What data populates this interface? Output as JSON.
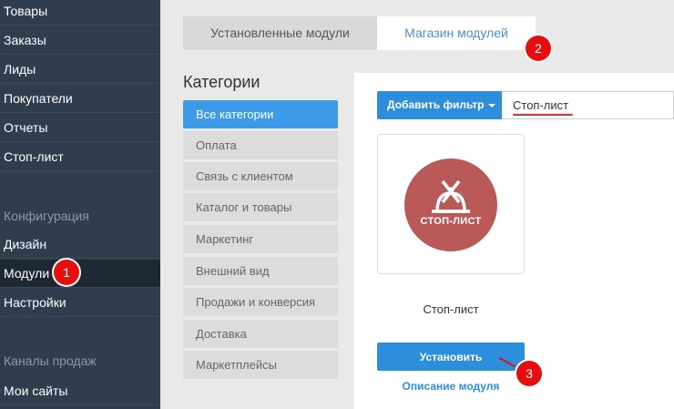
{
  "sidebar": {
    "items_top": [
      "Товары",
      "Заказы",
      "Лиды",
      "Покупатели",
      "Отчеты",
      "Стоп-лист"
    ],
    "config_header": "Конфигурация",
    "config_items": [
      "Дизайн",
      "Модули",
      "Настройки"
    ],
    "sales_header": "Каналы продаж",
    "sales_items": [
      "Мои сайты"
    ]
  },
  "tabs": {
    "installed": "Установленные модули",
    "store": "Магазин модулей"
  },
  "categories": {
    "title": "Категории",
    "items": [
      "Все категории",
      "Оплата",
      "Связь с клиентом",
      "Каталог и товары",
      "Маркетинг",
      "Внешний вид",
      "Продажи и конверсия",
      "Доставка",
      "Маркетплейсы"
    ]
  },
  "filter": {
    "button_label": "Добавить фильтр",
    "search_value": "Стоп-лист"
  },
  "module": {
    "logo_text": "СТОП-ЛИСТ",
    "name": "Стоп-лист",
    "install_label": "Установить",
    "description_link": "Описание модуля"
  },
  "markers": [
    "1",
    "2",
    "3"
  ],
  "colors": {
    "sidebar_bg": "#2f3d4c",
    "accent": "#2d8fdc",
    "logo_bg": "#b95a58",
    "marker": "#e60f0f"
  }
}
